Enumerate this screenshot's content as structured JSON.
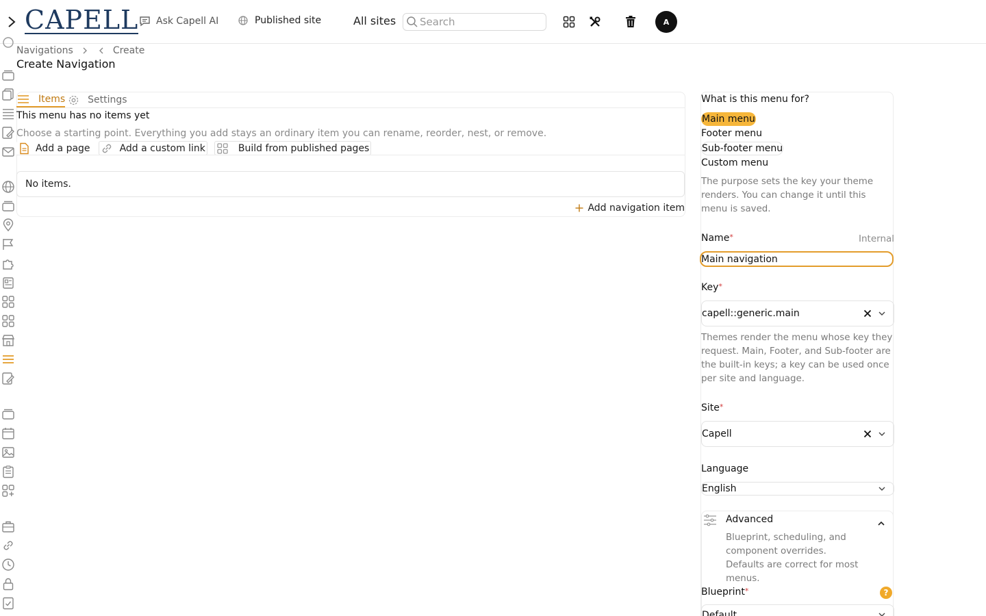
{
  "topbar": {
    "brand": "CAPELL",
    "ask_ai": "Ask Capell AI",
    "published_site": "Published site",
    "all_sites": "All sites",
    "search_placeholder": "Search",
    "avatar_initial": "A"
  },
  "breadcrumb": {
    "items": [
      "Navigations",
      "Create"
    ]
  },
  "page_title": "Create Navigation",
  "tabs": [
    {
      "label": "Items",
      "active": true
    },
    {
      "label": "Settings",
      "active": false
    }
  ],
  "items_panel": {
    "empty_title": "This menu has no items yet",
    "empty_desc": "Choose a starting point. Everything you add stays an ordinary item you can rename, reorder, nest, or remove.",
    "starters": [
      "Add a page",
      "Add a custom link",
      "Build from published pages"
    ],
    "no_items": "No items.",
    "add_item": "Add navigation item"
  },
  "settings_panel": {
    "purpose_question": "What is this menu for?",
    "purposes": [
      {
        "label": "Main menu",
        "selected": true
      },
      {
        "label": "Footer menu",
        "selected": false
      },
      {
        "label": "Sub-footer menu",
        "selected": false
      },
      {
        "label": "Custom menu",
        "selected": false
      }
    ],
    "purpose_help": "The purpose sets the key your theme renders. You can change it until this menu is saved.",
    "name_label": "Name",
    "name_hint": "Internal",
    "name_value": "Main navigation",
    "key_label": "Key",
    "key_value": "capell::generic.main",
    "key_help": "Themes render the menu whose key they request. Main, Footer, and Sub-footer are the built-in keys; a key can be used once per site and language.",
    "site_label": "Site",
    "site_value": "Capell",
    "language_label": "Language",
    "language_value": "English",
    "advanced_title": "Advanced",
    "advanced_desc_1": "Blueprint, scheduling, and component overrides.",
    "advanced_desc_2": "Defaults are correct for most menus.",
    "blueprint_label": "Blueprint",
    "blueprint_value": "Default",
    "required_mark": "*"
  },
  "colors": {
    "accent": "#e39c2b",
    "brand_navy": "#1e3a5f",
    "required": "#d23a3a"
  }
}
